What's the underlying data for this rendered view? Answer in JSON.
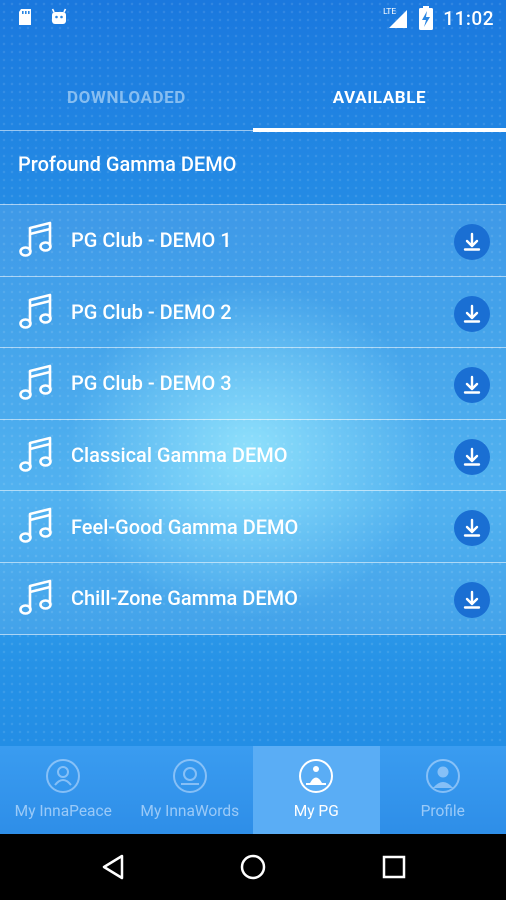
{
  "status_bar": {
    "time": "11:02",
    "network": "LTE",
    "icons": [
      "sd-card-icon",
      "android-icon",
      "lte-signal-icon",
      "battery-charging-icon"
    ]
  },
  "tabs": [
    {
      "label": "DOWNLOADED",
      "active": false
    },
    {
      "label": "AVAILABLE",
      "active": true
    }
  ],
  "section": {
    "title": "Profound Gamma DEMO"
  },
  "tracks": [
    {
      "title": "PG Club - DEMO 1",
      "icon": "music-note-icon",
      "action_icon": "download-icon"
    },
    {
      "title": "PG Club - DEMO 2",
      "icon": "music-note-icon",
      "action_icon": "download-icon"
    },
    {
      "title": "PG Club - DEMO 3",
      "icon": "music-note-icon",
      "action_icon": "download-icon"
    },
    {
      "title": "Classical Gamma DEMO",
      "icon": "music-note-icon",
      "action_icon": "download-icon"
    },
    {
      "title": "Feel-Good Gamma DEMO",
      "icon": "music-note-icon",
      "action_icon": "download-icon"
    },
    {
      "title": "Chill-Zone Gamma DEMO",
      "icon": "music-note-icon",
      "action_icon": "download-icon"
    }
  ],
  "bottom_nav": [
    {
      "label": "My InnaPeace",
      "icon": "innapeace-icon",
      "active": false
    },
    {
      "label": "My InnaWords",
      "icon": "innawords-icon",
      "active": false
    },
    {
      "label": "My PG",
      "icon": "meditation-icon",
      "active": true
    },
    {
      "label": "Profile",
      "icon": "profile-icon",
      "active": false
    }
  ],
  "system_nav": {
    "icons": [
      "back-icon",
      "home-icon",
      "recents-icon"
    ]
  },
  "colors": {
    "accent": "#1a6fd3",
    "background_top": "#1a78de",
    "active_nav": "#5aadf5"
  }
}
